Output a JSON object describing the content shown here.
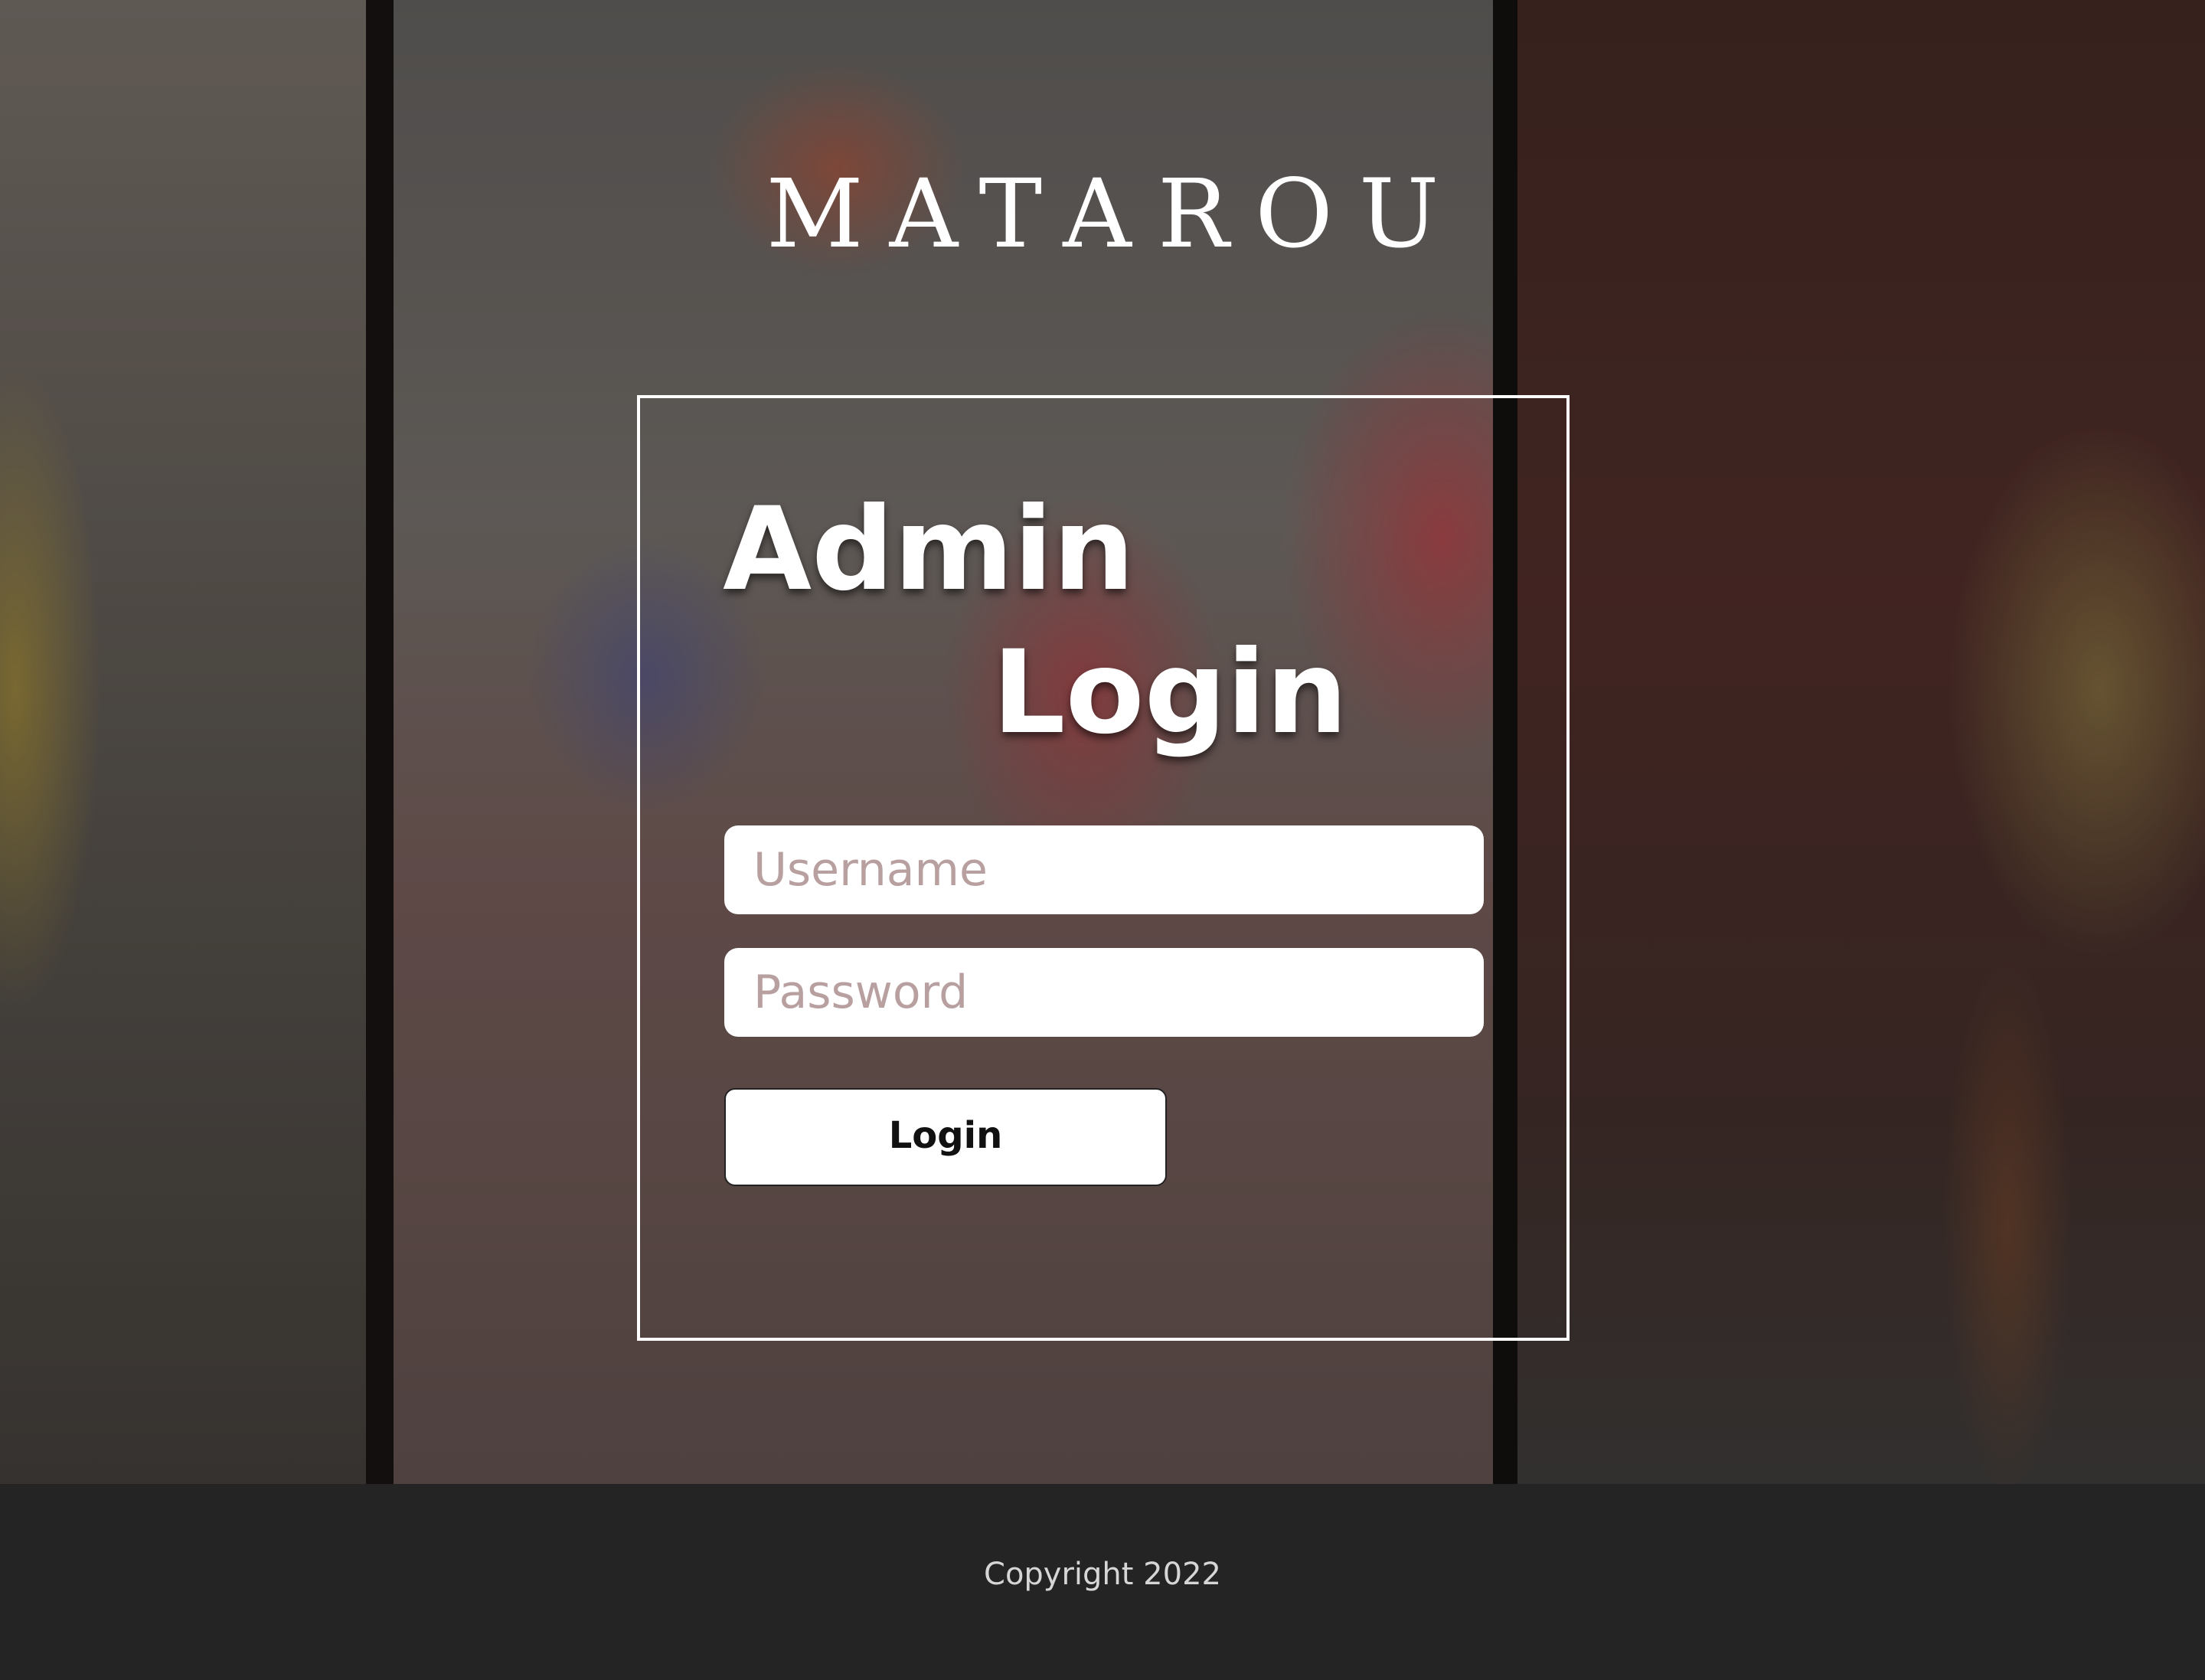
{
  "brand": {
    "logo_text": "MATAROU"
  },
  "login": {
    "title_line1": "Admin",
    "title_line2": "Login",
    "username_placeholder": "Username",
    "password_placeholder": "Password",
    "submit_label": "Login"
  },
  "footer": {
    "copyright": "Copyright 2022"
  }
}
